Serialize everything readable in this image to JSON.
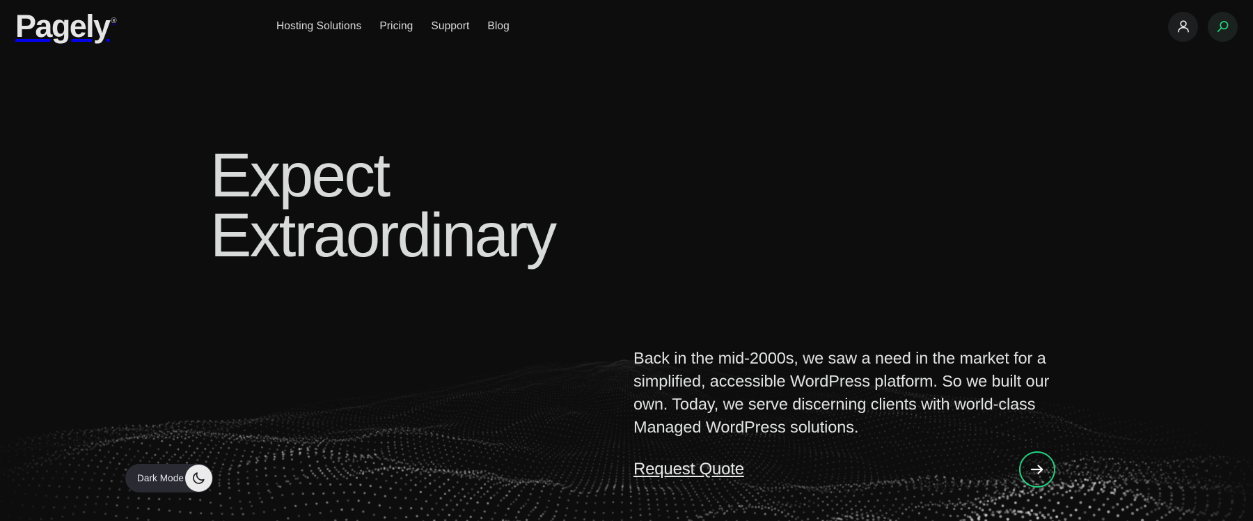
{
  "page": {
    "background_color": "#0d0d0d",
    "accent_color": "#1fd47f",
    "text_color": "#e2e4e3"
  },
  "header": {
    "brand": {
      "wordmark": "Pagely",
      "registered_mark": "®"
    },
    "nav_items": [
      {
        "label": "Hosting Solutions"
      },
      {
        "label": "Pricing"
      },
      {
        "label": "Support"
      },
      {
        "label": "Blog"
      }
    ],
    "actions": [
      {
        "icon": "user-account-icon",
        "color": "#e8e8e8"
      },
      {
        "icon": "search-icon",
        "color": "#1fd47f"
      }
    ]
  },
  "hero": {
    "heading": "Expect\nExtraordinary",
    "paragraph": "Back in the mid-2000s, we saw a need in the market for a simplified, accessible WordPress platform. So we built our own. Today, we serve discerning clients with world-class Managed WordPress solutions.",
    "cta": {
      "label": "Request Quote",
      "arrow_icon": "arrow-right-icon",
      "arrow_color": "#1fd47f"
    }
  },
  "dark_mode_toggle": {
    "label": "Dark Mode",
    "state": "on",
    "knob_icon": "crescent-moon-icon",
    "track_color": "#2a2a33",
    "knob_color": "#ebebeb"
  }
}
